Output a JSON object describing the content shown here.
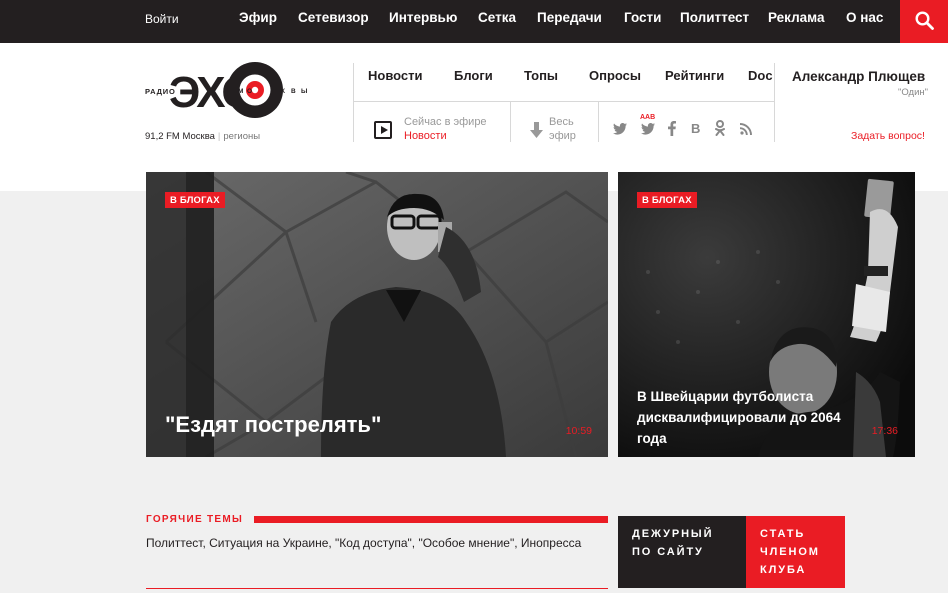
{
  "topbar": {
    "login": "Войти",
    "nav": [
      "Эфир",
      "Сетевизор",
      "Интервью",
      "Сетка",
      "Передачи",
      "Гости",
      "Политтест",
      "Реклама",
      "О нас"
    ]
  },
  "logo": {
    "radio": "РАДИО",
    "echo": "ЭХО",
    "moscow_letters": [
      "М",
      "О",
      "С",
      "К",
      "В",
      "Ы"
    ]
  },
  "frequency": {
    "fm": "91,2 FM Москва",
    "separator": "|",
    "regions": "регионы"
  },
  "secondary_nav": [
    "Новости",
    "Блоги",
    "Топы",
    "Опросы",
    "Рейтинги",
    "Doc"
  ],
  "host": {
    "name": "Александр Плющев",
    "program": "\"Один\"",
    "ask": "Задать вопрос!"
  },
  "on_air": {
    "label": "Сейчас в эфире",
    "program": "Новости"
  },
  "all_air": {
    "line1": "Весь",
    "line2": "эфир"
  },
  "social": {
    "aab": "ААВ",
    "icons": [
      "twitter-icon",
      "twitter-aab-icon",
      "facebook-icon",
      "vkontakte-icon",
      "odnoklassniki-icon",
      "rss-icon"
    ]
  },
  "cards": [
    {
      "badge": "В БЛОГАХ",
      "title": "\"Ездят пострелять\"",
      "time": "10:59"
    },
    {
      "badge": "В БЛОГАХ",
      "title": "В Швейцарии футболиста дисквалифицировали до 2064 года",
      "time": "17:36"
    }
  ],
  "hot_topics": {
    "label": "ГОРЯЧИЕ ТЕМЫ",
    "text": "Политтест, Ситуация на Украине, \"Код доступа\", \"Особое мнение\", Инопресса"
  },
  "buttons": {
    "duty_1": "ДЕЖУРНЫЙ",
    "duty_2": "ПО САЙТУ",
    "member_1": "СТАТЬ",
    "member_2": "ЧЛЕНОМ",
    "member_3": "КЛУБА"
  },
  "colors": {
    "accent": "#ea1c24",
    "dark": "#231f20",
    "background": "#f0f0f0"
  }
}
